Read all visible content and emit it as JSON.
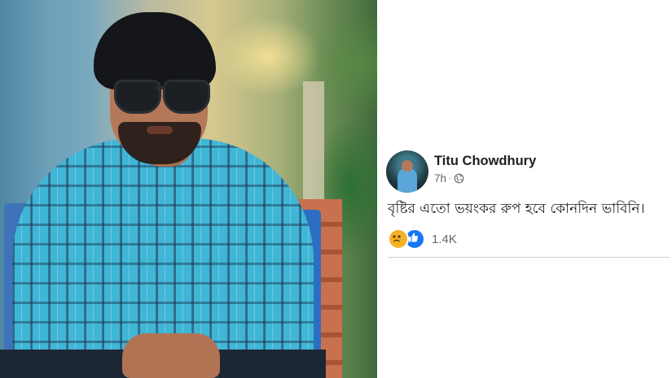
{
  "photo": {
    "subject": "portrait"
  },
  "post": {
    "author": "Titu Chowdhury",
    "time": "7h",
    "separator": "·",
    "privacy_icon": "globe-icon",
    "text": "বৃষ্টির এতো ভয়ংকর রুপ হবে কোনদিন ভাবিনি।",
    "reactions": {
      "icons": [
        "sad-reaction-icon",
        "like-reaction-icon"
      ],
      "count": "1.4K"
    }
  },
  "colors": {
    "name_text": "#1c1e21",
    "meta_text": "#65676b",
    "like_blue": "#1877f2",
    "sad_yellow": "#f7b125",
    "divider": "#ced0d4"
  }
}
